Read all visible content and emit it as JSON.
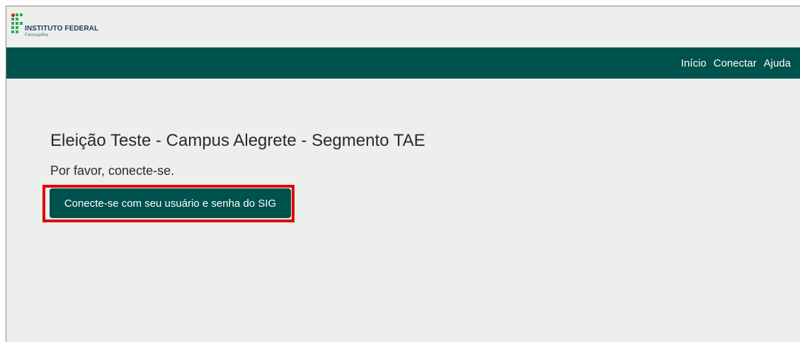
{
  "brand": {
    "title": "INSTITUTO FEDERAL",
    "subtitle": "Farroupilha",
    "colors": {
      "primary": "#00524c",
      "logo_green": "#2fa84f",
      "logo_red": "#e0201f",
      "background": "#ecefeb",
      "highlight": "#e00000"
    }
  },
  "nav": {
    "items": [
      {
        "label": "Início"
      },
      {
        "label": "Conectar"
      },
      {
        "label": "Ajuda"
      }
    ]
  },
  "main": {
    "title": "Eleição Teste - Campus Alegrete - Segmento TAE",
    "prompt": "Por favor, conecte-se.",
    "login_button": "Conecte-se com seu usuário e senha do SIG"
  }
}
